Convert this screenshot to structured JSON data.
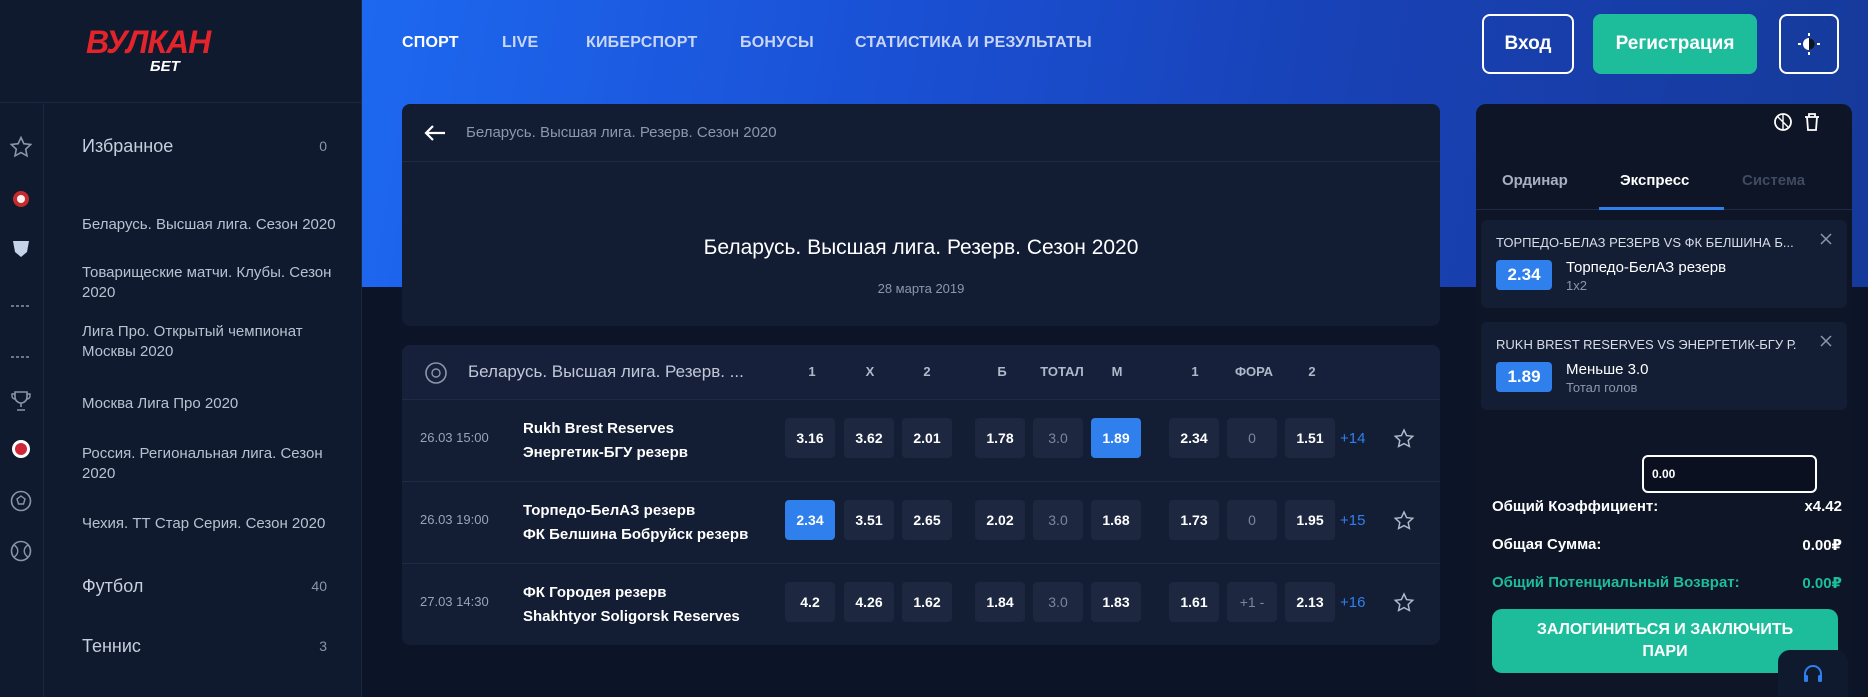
{
  "logo": {
    "main": "ВУЛКАН",
    "sub": "БЕТ"
  },
  "nav": [
    "СПОРТ",
    "LIVE",
    "КИБЕРСПОРТ",
    "БОНУСЫ",
    "СТАТИСТИКА И РЕЗУЛЬТАТЫ"
  ],
  "header": {
    "login": "Вход",
    "register": "Регистрация"
  },
  "sidebar": {
    "favorites": {
      "label": "Избранное",
      "count": "0"
    },
    "items": [
      "Беларусь. Высшая лига. Сезон 2020",
      "Товарищеские матчи. Клубы. Сезон 2020",
      "Лига Про. Открытый чемпионат Москвы 2020",
      "Москва Лига Про 2020",
      "Россия. Региональная лига. Сезон 2020",
      "Чехия. ТТ Стар Серия. Сезон 2020"
    ],
    "sports": [
      {
        "label": "Футбол",
        "count": "40"
      },
      {
        "label": "Теннис",
        "count": "3"
      }
    ]
  },
  "event": {
    "breadcrumb": "Беларусь. Высшая лига. Резерв. Сезон 2020",
    "title": "Беларусь. Высшая лига. Резерв. Сезон 2020",
    "date": "28 марта 2019"
  },
  "table": {
    "league": "Беларусь. Высшая лига. Резерв. ...",
    "headers": [
      "1",
      "X",
      "2",
      "Б",
      "ТОТАЛ",
      "М",
      "1",
      "ФОРА",
      "2"
    ],
    "rows": [
      {
        "time": "26.03  15:00",
        "home": "Rukh Brest Reserves",
        "away": "Энергетик-БГУ резерв",
        "odds": [
          "3.16",
          "3.62",
          "2.01",
          "1.78",
          "3.0",
          "1.89",
          "2.34",
          "0",
          "1.51"
        ],
        "more": "+14"
      },
      {
        "time": "26.03  19:00",
        "home": "Торпедо-БелАЗ резерв",
        "away": "ФК Белшина Бобруйск резерв",
        "odds": [
          "2.34",
          "3.51",
          "2.65",
          "2.02",
          "3.0",
          "1.68",
          "1.73",
          "0",
          "1.95"
        ],
        "more": "+15"
      },
      {
        "time": "27.03  14:30",
        "home": "ФК Городея резерв",
        "away": "Shakhtyor Soligorsk Reserves",
        "odds": [
          "4.2",
          "4.26",
          "1.62",
          "1.84",
          "3.0",
          "1.83",
          "1.61",
          "+1 -",
          "2.13"
        ],
        "more": "+16"
      }
    ]
  },
  "slip": {
    "tabs": [
      "Ординар",
      "Экспресс",
      "Система"
    ],
    "bets": [
      {
        "match": "ТОРПЕДО-БЕЛАЗ РЕЗЕРВ VS ФК БЕЛШИНА Б...",
        "coef": "2.34",
        "pick": "Торпедо-БелАЗ резерв",
        "type": "1x2"
      },
      {
        "match": "RUKH BREST RESERVES VS ЭНЕРГЕТИК-БГУ Р...",
        "coef": "1.89",
        "pick": "Меньше 3.0",
        "type": "Тотал голов"
      }
    ],
    "stake": "0.00",
    "total_coef_label": "Общий Коэффициент:",
    "total_coef": "x4.42",
    "total_sum_label": "Общая Сумма:",
    "total_sum": "0.00₽",
    "potential_label": "Общий Потенциальный Возврат:",
    "potential": "0.00₽",
    "cta_line1": "ЗАЛОГИНИТЬСЯ И ЗАКЛЮЧИТЬ",
    "cta_line2": "ПАРИ"
  },
  "colors": {
    "accent": "#2f80ed",
    "brand": "#e3242b",
    "success": "#1dbd9c",
    "background": "#0c1427"
  }
}
